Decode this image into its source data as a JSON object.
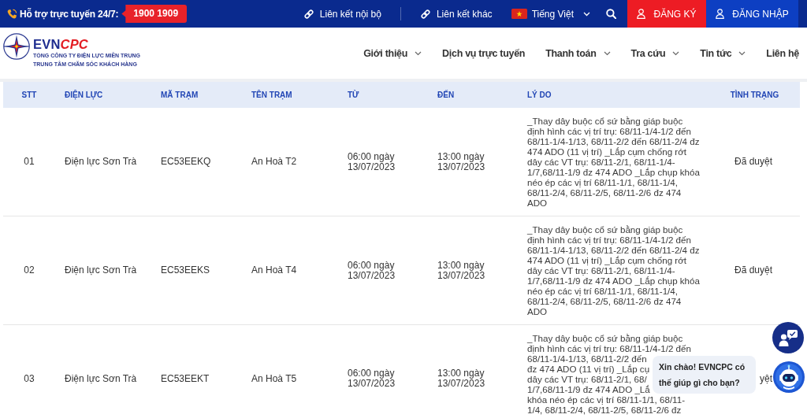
{
  "top_bar": {
    "hotline_label": "Hỗ trợ trực tuyến 24/7:",
    "hotline_number": "1900 1909",
    "links": [
      "Liên kết nội bộ",
      "Liên kết khác"
    ],
    "language": "Tiếng Việt",
    "buttons": [
      {
        "label": "ĐĂNG KÝ",
        "kind": "register"
      },
      {
        "label": "ĐĂNG NHẬP",
        "kind": "login"
      }
    ]
  },
  "header": {
    "brand": {
      "main": "EVN",
      "accent": "CPC"
    },
    "subtitles": [
      "TỔNG CÔNG TY ĐIỆN LỰC MIỀN TRUNG",
      "TRUNG TÂM CHĂM SÓC KHÁCH HÀNG"
    ],
    "nav": [
      {
        "label": "Giới thiệu",
        "has_menu": true
      },
      {
        "label": "Dịch vụ trực tuyến",
        "has_menu": false
      },
      {
        "label": "Thanh toán",
        "has_menu": true
      },
      {
        "label": "Tra cứu",
        "has_menu": true
      },
      {
        "label": "Tin tức",
        "has_menu": true
      },
      {
        "label": "Liên hệ",
        "has_menu": false
      }
    ]
  },
  "table": {
    "columns": [
      "STT",
      "ĐIỆN LỰC",
      "MÃ TRẠM",
      "TÊN TRẠM",
      "TỪ",
      "ĐẾN",
      "LÝ DO",
      "TÌNH TRẠNG"
    ],
    "rows": [
      {
        "stt": "01",
        "dien_luc": "Điện lực Sơn Trà",
        "ma_tram": "EC53EEKQ",
        "ten_tram": "An Hoà T2",
        "tu": "06:00 ngày 13/07/2023",
        "den": "13:00 ngày 13/07/2023",
        "ly_do": "_Thay dây buộc cổ sứ bằng giáp buộc định hình các vị trí trụ: 68/11-1/4-1/2 đến 68/11-1/4-1/13, 68/11-2/2 đến 68/11-2/4 đz 474 ADO (11 vị trí) _Lắp cụm chống rớt dây các VT trụ: 68/11-2/1, 68/11-1/4-1/7,68/11-1/9 đz 474 ADO _Lắp chụp khóa néo ép các vị trí 68/11-1/1, 68/11-1/4, 68/11-2/4, 68/11-2/5, 68/11-2/6 đz 474 ADO",
        "tinh_trang": "Đã duyệt"
      },
      {
        "stt": "02",
        "dien_luc": "Điện lực Sơn Trà",
        "ma_tram": "EC53EEKS",
        "ten_tram": "An Hoà T4",
        "tu": "06:00 ngày 13/07/2023",
        "den": "13:00 ngày 13/07/2023",
        "ly_do": "_Thay dây buộc cổ sứ bằng giáp buộc định hình các vị trí trụ: 68/11-1/4-1/2 đến 68/11-1/4-1/13, 68/11-2/2 đến 68/11-2/4 đz 474 ADO (11 vị trí) _Lắp cụm chống rớt dây các VT trụ: 68/11-2/1, 68/11-1/4-1/7,68/11-1/9 đz 474 ADO _Lắp chụp khóa néo ép các vị trí 68/11-1/1, 68/11-1/4, 68/11-2/4, 68/11-2/5, 68/11-2/6 đz 474 ADO",
        "tinh_trang": "Đã duyệt"
      },
      {
        "stt": "03",
        "dien_luc": "Điện lực Sơn Trà",
        "ma_tram": "EC53EEKT",
        "ten_tram": "An Hoà T5",
        "tu": "06:00 ngày 13/07/2023",
        "den": "13:00 ngày 13/07/2023",
        "ly_do": [
          "_Thay dây buộc cổ sứ bằng giáp buộc",
          "định hình các vị trí trụ: 68/11-1/4-1/2 đến",
          "68/11-1/4-1/13, 68/11-2/2 đến",
          "đz 474 ADO (11 vị trí) _Lắp cụ",
          "dây các VT trụ: 68/11-2/1, 68/",
          "1/7,68/11-1/9 đz 474 ADO _Lắ",
          "khóa néo ép các vị trí 68/11-1/1, 68/11-",
          "1/4, 68/11-2/4, 68/11-2/5, 68/11-2/6 đz"
        ],
        "tinh_trang": "yệt"
      }
    ]
  },
  "chat": {
    "greeting": "Xin chào! EVNCPC có thế giúp gì cho bạn?"
  }
}
